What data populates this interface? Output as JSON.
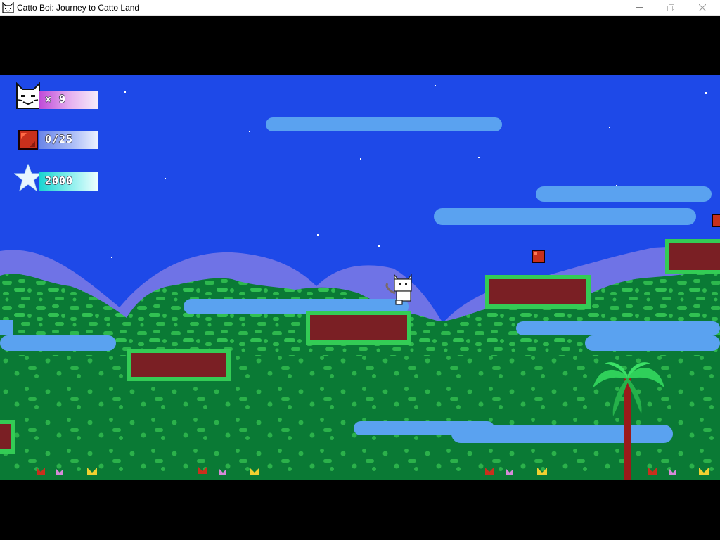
{
  "window": {
    "title": "Catto Boi: Journey to Catto Land",
    "controls": [
      "minimize",
      "maximize",
      "close"
    ]
  },
  "hud": {
    "lives": {
      "icon": "cat-face-icon",
      "text": "× 9"
    },
    "gems": {
      "icon": "red-gem-icon",
      "text": "0/25"
    },
    "score": {
      "icon": "star-icon",
      "text": "2000"
    }
  },
  "colors": {
    "sky": "#1e49e8",
    "mountains": "#6f73e6",
    "foliage": "#0a7a35",
    "foliage_light": "#2db84d",
    "cloud": "#5aa2f0",
    "platform_fill": "#7a1f24",
    "platform_border": "#33cc55",
    "gem": "#c8301c"
  }
}
